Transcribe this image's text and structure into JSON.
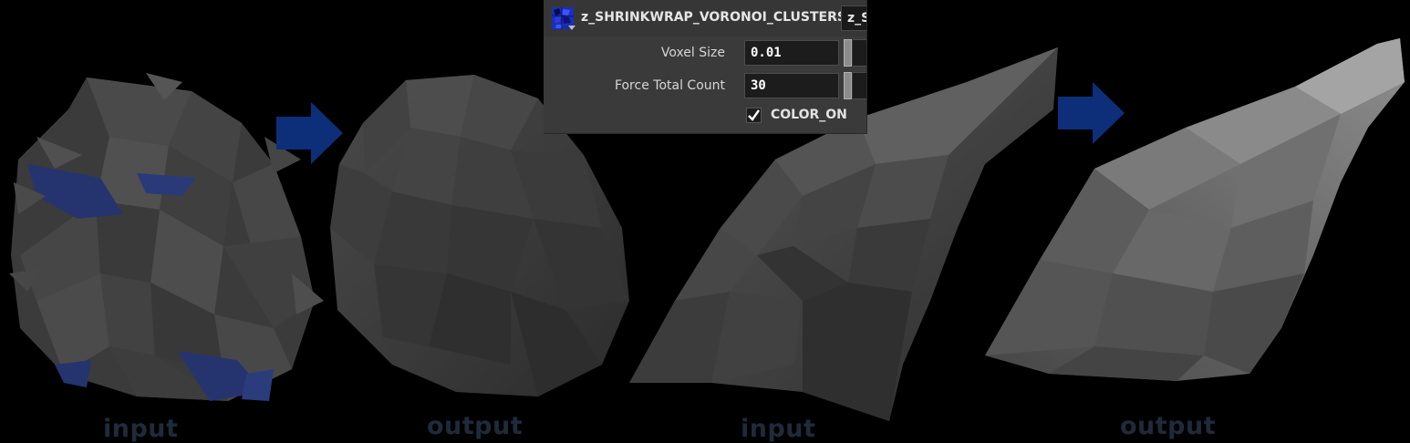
{
  "captions": {
    "first_input": "input",
    "first_output": "output",
    "second_input": "input",
    "second_output": "output"
  },
  "panel": {
    "node_type_icon": "voronoi-node-icon",
    "node_name": "z_SHRINKWRAP_VORONOI_CLUSTERS",
    "node_field_value": "z_S",
    "params": {
      "voxel_size_label": "Voxel Size",
      "voxel_size_value": "0.01",
      "force_total_count_label": "Force Total Count",
      "force_total_count_value": "30",
      "color_on_label": "COLOR_ON",
      "color_on_checked": true
    }
  },
  "colors": {
    "background": "#000000",
    "arrow": "#0d2f7a",
    "caption": "#1f2b3a",
    "rock_dark": "#3c3c3c",
    "rock_light": "#6a6a6a",
    "shard_blue": "#25346e",
    "panel_bg": "#3a3a3a",
    "field_bg": "#1c1c1c"
  },
  "icons": [
    "arrow-right-icon",
    "voronoi-node-icon",
    "checkmark-icon"
  ]
}
